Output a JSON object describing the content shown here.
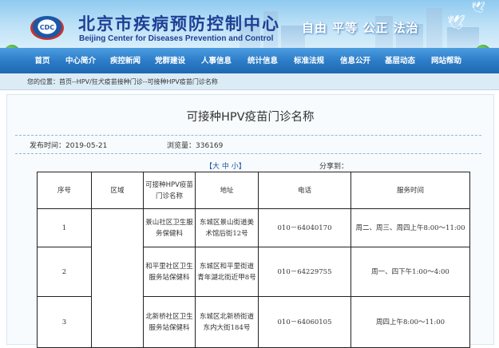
{
  "header": {
    "logo_text": "CDC",
    "title": "北京市疾病预防控制中心",
    "subtitle": "Beijing Center for Diseases Prevention and Control",
    "motto": "自由 平等 公正 法治"
  },
  "nav": {
    "items": [
      {
        "label": "首页"
      },
      {
        "label": "中心简介"
      },
      {
        "label": "疾控新闻"
      },
      {
        "label": "党群建设"
      },
      {
        "label": "人事信息"
      },
      {
        "label": "统计信息"
      },
      {
        "label": "标准法规"
      },
      {
        "label": "信息公开"
      },
      {
        "label": "基层动态"
      },
      {
        "label": "网站帮助"
      }
    ]
  },
  "breadcrumb": {
    "text": "您的位置：首页--HPV/狂犬疫苗接种门诊--可接种HPV疫苗门诊名称"
  },
  "article": {
    "title": "可接种HPV疫苗门诊名称",
    "publish_label": "发布时间：",
    "publish_date": "2019-05-21",
    "views_label": "浏览量：",
    "views": "336169",
    "font_size_control": "【大 中 小】",
    "share_label": "分享到："
  },
  "table": {
    "headers": [
      "序号",
      "区域",
      "可接种HPV疫苗门诊名称",
      "地址",
      "电话",
      "服务时间"
    ],
    "rows": [
      {
        "no": "1",
        "district": "",
        "name": "景山社区卫生服务保健科",
        "address": "东城区景山街道美术馆后街12号",
        "phone": "010－64040170",
        "hours": "周二、周三、周四上午8:00～11:00"
      },
      {
        "no": "2",
        "district": "",
        "name": "和平里社区卫生服务站保健科",
        "address": "东城区和平里街道青年湖北街近甲8号",
        "phone": "010－64229755",
        "hours": "周一、四下午1:00～4:00"
      },
      {
        "no": "3",
        "district": "",
        "name": "北新桥社区卫生服务站保健科",
        "address": "东城区北新桥街道东内大街184号",
        "phone": "010－64060105",
        "hours": "周四上午8:00～11:00"
      }
    ]
  }
}
